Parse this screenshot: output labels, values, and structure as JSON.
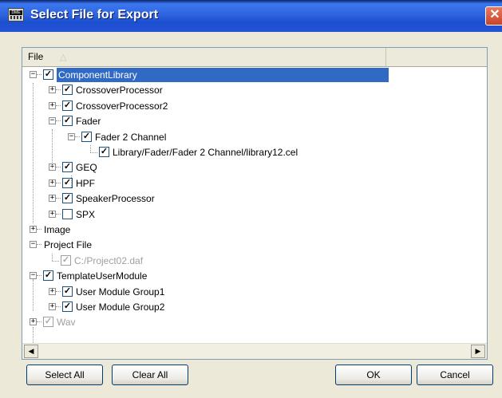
{
  "window": {
    "title": "Select File for Export",
    "close_glyph": "✕",
    "icon_label": "DME",
    "icon": "dme-app-icon"
  },
  "list": {
    "column_header": "File",
    "sort_glyph": "△"
  },
  "tree": [
    {
      "label": "ComponentLibrary",
      "level": 0,
      "expander": "−",
      "checked": true,
      "selected": true
    },
    {
      "label": "CrossoverProcessor",
      "level": 1,
      "expander": "+",
      "checked": true
    },
    {
      "label": "CrossoverProcessor2",
      "level": 1,
      "expander": "+",
      "checked": true
    },
    {
      "label": "Fader",
      "level": 1,
      "expander": "−",
      "checked": true
    },
    {
      "label": "Fader  2 Channel",
      "level": 2,
      "expander": "−",
      "checked": true
    },
    {
      "label": "Library/Fader/Fader  2 Channel/library12.cel",
      "level": 3,
      "expander": "",
      "checked": true
    },
    {
      "label": "GEQ",
      "level": 1,
      "expander": "+",
      "checked": true
    },
    {
      "label": "HPF",
      "level": 1,
      "expander": "+",
      "checked": true
    },
    {
      "label": "SpeakerProcessor",
      "level": 1,
      "expander": "+",
      "checked": true
    },
    {
      "label": "SPX",
      "level": 1,
      "expander": "+",
      "checked": false
    },
    {
      "label": "Image",
      "level": 0,
      "expander": "+",
      "checkbox": false
    },
    {
      "label": "Project File",
      "level": 0,
      "expander": "−",
      "checkbox": false
    },
    {
      "label": "C:/Project02.daf",
      "level": 1,
      "expander": "",
      "checked": true,
      "disabled": true
    },
    {
      "label": "TemplateUserModule",
      "level": 0,
      "expander": "−",
      "checked": true
    },
    {
      "label": "User Module Group1",
      "level": 1,
      "expander": "+",
      "checked": true
    },
    {
      "label": "User Module Group2",
      "level": 1,
      "expander": "+",
      "checked": true
    },
    {
      "label": "Wav",
      "level": 0,
      "expander": "+",
      "checked": true,
      "disabled": true
    }
  ],
  "scrollbar": {
    "left_arrow": "◀",
    "right_arrow": "▶"
  },
  "buttons": {
    "select_all": "Select All",
    "clear_all": "Clear All",
    "ok": "OK",
    "cancel": "Cancel"
  },
  "colors": {
    "title_bar": "#2f65df",
    "selection": "#316ac5",
    "dialog_bg": "#ece9d8",
    "close_button": "#c8432a"
  }
}
